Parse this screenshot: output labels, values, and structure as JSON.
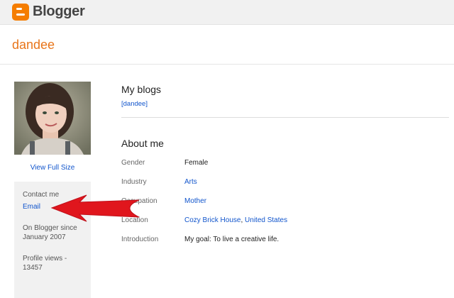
{
  "header": {
    "app_name": "Blogger",
    "brand_color": "#f57d00"
  },
  "profile": {
    "username": "dandee",
    "view_full_size": "View Full Size",
    "contact_label": "Contact me",
    "email_link": "Email",
    "on_blogger_line1": "On Blogger since",
    "on_blogger_line2": "January 2007",
    "views_line1": "Profile views -",
    "views_line2": "13457"
  },
  "my_blogs": {
    "title": "My blogs",
    "blogs": [
      "[dandee]"
    ]
  },
  "about": {
    "title": "About me",
    "rows": [
      {
        "label": "Gender",
        "value": "Female"
      },
      {
        "label": "Industry",
        "value": "Arts"
      },
      {
        "label": "Occupation",
        "value": "Mother"
      },
      {
        "label": "Location",
        "value_1": "Cozy Brick House",
        "sep": ",",
        "value_2": "United States"
      },
      {
        "label": "Introduction",
        "value": "My goal: To live a creative life."
      }
    ]
  },
  "annotation": {
    "arrow_color": "#e0161d",
    "icon": "red-arrow-pointing-left"
  }
}
